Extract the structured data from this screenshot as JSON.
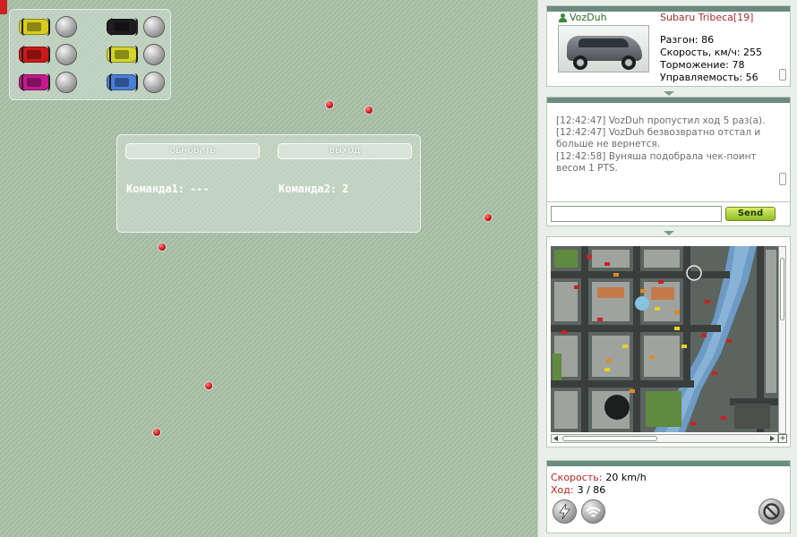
{
  "cars_panel": {
    "cars": [
      {
        "color": "#d8cc20"
      },
      {
        "color": "#1d1d1d"
      },
      {
        "color": "#cc1a1a"
      },
      {
        "color": "#d3d62a"
      },
      {
        "color": "#c41a8e"
      },
      {
        "color": "#4a7fd8"
      }
    ]
  },
  "dialog": {
    "refresh_label": "ОБНОВИТЬ",
    "exit_label": "ВЫХОД",
    "team1_label": "Команда1:",
    "team1_value": "---",
    "team2_label": "Команда2:",
    "team2_value": "2"
  },
  "player": {
    "nick": "VozDuh",
    "car_name": "Subaru Tribeca[19]",
    "stats": [
      "Разгон: 86",
      "Скорость, км/ч: 255",
      "Торможение: 78",
      "Управляемость: 56"
    ]
  },
  "chat": {
    "messages": [
      "[12:42:47] VozDuh пропустил ход 5 раз(а).",
      "[12:42:47] VozDuh безвозвратно отстал и больше не вернется.",
      "[12:42:58] Вуняша подобрала чек-поинт весом 1 PTS."
    ],
    "input_value": "",
    "send_label": "Send"
  },
  "status": {
    "speed_label": "Скорость:",
    "speed_value": "20 km/h",
    "turn_label": "Ход:",
    "turn_value": "3 / 86"
  },
  "icons": {
    "nitro": "lightning-icon",
    "signal": "wifi-icon",
    "cancel": "forbidden-icon"
  }
}
